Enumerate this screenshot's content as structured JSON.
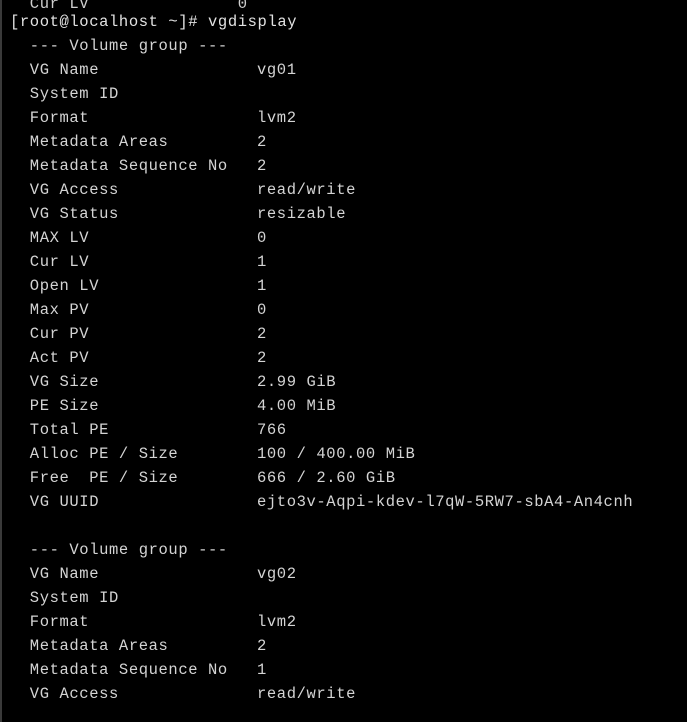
{
  "terminal": {
    "background_color": "#000000",
    "text_color": "#d4d4d4",
    "overflow_line": "  Cur LV               0",
    "prompt": "[root@localhost ~]# vgdisplay",
    "group_header": "  --- Volume group ---",
    "blank": " "
  },
  "volume_groups": [
    {
      "header": "  --- Volume group ---",
      "fields": [
        {
          "key": "  VG Name",
          "value": "vg01"
        },
        {
          "key": "  System ID",
          "value": ""
        },
        {
          "key": "  Format",
          "value": "lvm2"
        },
        {
          "key": "  Metadata Areas",
          "value": "2"
        },
        {
          "key": "  Metadata Sequence No",
          "value": "2"
        },
        {
          "key": "  VG Access",
          "value": "read/write"
        },
        {
          "key": "  VG Status",
          "value": "resizable"
        },
        {
          "key": "  MAX LV",
          "value": "0"
        },
        {
          "key": "  Cur LV",
          "value": "1"
        },
        {
          "key": "  Open LV",
          "value": "1"
        },
        {
          "key": "  Max PV",
          "value": "0"
        },
        {
          "key": "  Cur PV",
          "value": "2"
        },
        {
          "key": "  Act PV",
          "value": "2"
        },
        {
          "key": "  VG Size",
          "value": "2.99 GiB"
        },
        {
          "key": "  PE Size",
          "value": "4.00 MiB"
        },
        {
          "key": "  Total PE",
          "value": "766"
        },
        {
          "key": "  Alloc PE / Size",
          "value": "100 / 400.00 MiB"
        },
        {
          "key": "  Free  PE / Size",
          "value": "666 / 2.60 GiB"
        },
        {
          "key": "  VG UUID",
          "value": "ejto3v-Aqpi-kdev-l7qW-5RW7-sbA4-An4cnh"
        }
      ]
    },
    {
      "header": "  --- Volume group ---",
      "fields": [
        {
          "key": "  VG Name",
          "value": "vg02"
        },
        {
          "key": "  System ID",
          "value": ""
        },
        {
          "key": "  Format",
          "value": "lvm2"
        },
        {
          "key": "  Metadata Areas",
          "value": "2"
        },
        {
          "key": "  Metadata Sequence No",
          "value": "1"
        },
        {
          "key": "  VG Access",
          "value": "read/write"
        }
      ]
    }
  ]
}
